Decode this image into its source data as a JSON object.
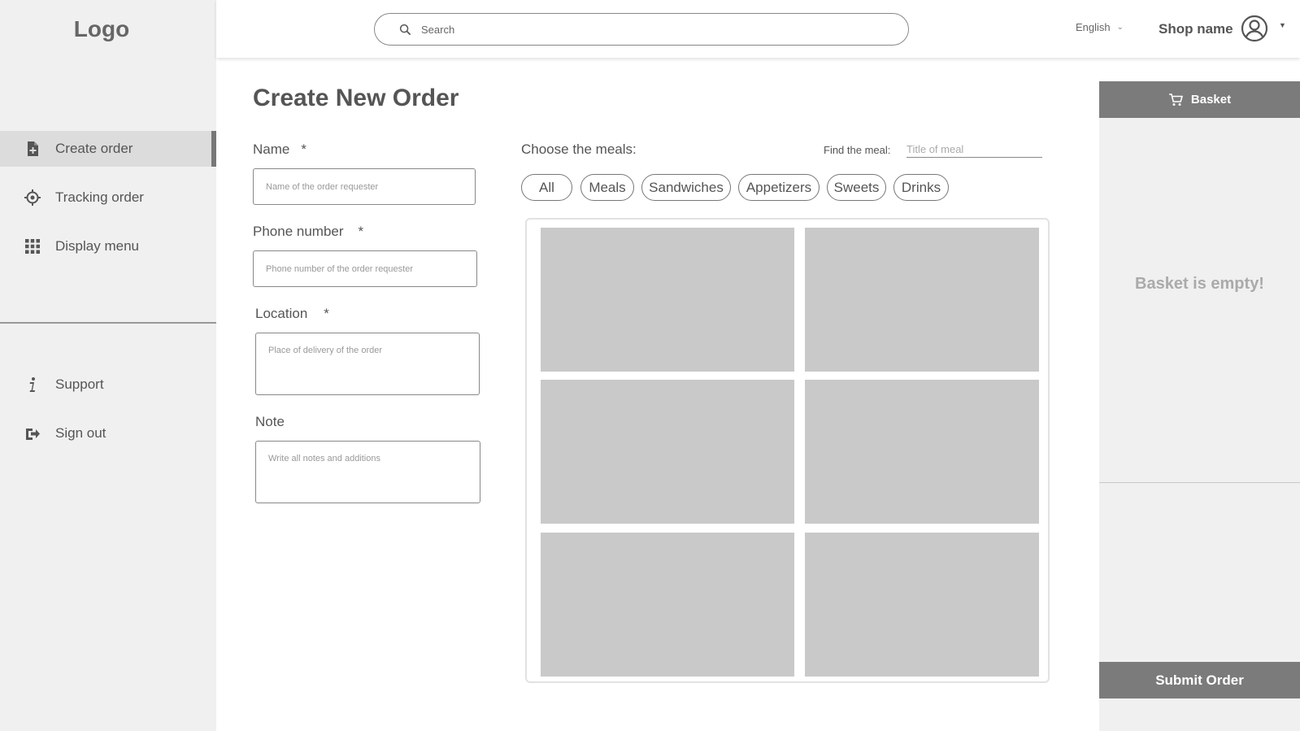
{
  "sidebar": {
    "logo": "Logo",
    "nav": [
      {
        "label": "Create order",
        "icon": "file-plus-icon",
        "active": true
      },
      {
        "label": "Tracking order",
        "icon": "crosshair-icon",
        "active": false
      },
      {
        "label": "Display menu",
        "icon": "grid-icon",
        "active": false
      }
    ],
    "bottom_nav": [
      {
        "label": "Support",
        "icon": "info-icon"
      },
      {
        "label": "Sign out",
        "icon": "sign-out-icon"
      }
    ]
  },
  "topbar": {
    "search_placeholder": "Search",
    "search_icon": "search-icon",
    "language": "English",
    "shop_name": "Shop name",
    "avatar_icon": "user-circle-icon"
  },
  "form": {
    "title": "Create New Order",
    "name": {
      "label": "Name",
      "required_mark": "*",
      "placeholder": "Name of the order requester"
    },
    "phone": {
      "label": "Phone number",
      "required_mark": "*",
      "placeholder": "Phone number of the order requester"
    },
    "location": {
      "label": "Location",
      "required_mark": "*",
      "placeholder": "Place of delivery of the order"
    },
    "note": {
      "label": "Note",
      "placeholder": "Write all notes and additions"
    }
  },
  "meals": {
    "label": "Choose the meals:",
    "find_label": "Find the meal:",
    "find_placeholder": "Title of meal",
    "categories": [
      "All",
      "Meals",
      "Sandwiches",
      "Appetizers",
      "Sweets",
      "Drinks"
    ],
    "selected_category": "All",
    "card_count": 6
  },
  "basket": {
    "title": "Basket",
    "icon": "cart-icon",
    "empty_text": "Basket is empty!",
    "submit_label": "Submit Order"
  },
  "colors": {
    "sidebar_bg": "#f0f0f0",
    "active_bg": "#dcdcdc",
    "card_bg": "#c9c9c9",
    "basket_header_bg": "#7b7b7b"
  }
}
